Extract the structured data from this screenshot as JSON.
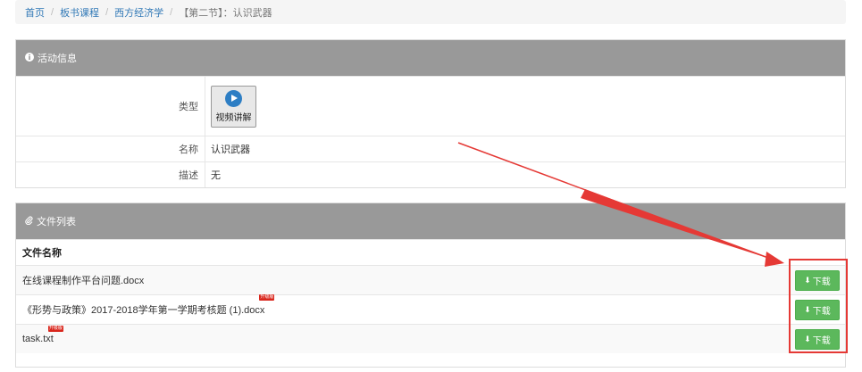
{
  "breadcrumb": {
    "home": "首页",
    "courses": "板书课程",
    "subject": "西方经济学",
    "current": "【第二节】：认识武器"
  },
  "activity": {
    "title": "活动信息",
    "type_label": "类型",
    "type_value": "视频讲解",
    "name_label": "名称",
    "name_value": "认识武器",
    "desc_label": "描述",
    "desc_value": "无"
  },
  "files": {
    "title": "文件列表",
    "column_header": "文件名称",
    "download_label": "下载",
    "badge_text": "升级版",
    "rows": [
      {
        "name": "在线课程制作平台问题.docx"
      },
      {
        "name": "《形势与政策》2017-2018学年第一学期考核题 (1).docx"
      },
      {
        "name": "task.txt"
      }
    ]
  },
  "colors": {
    "panel_header": "#999999",
    "link": "#337ab7",
    "download_button": "#5cb85c",
    "highlight": "#e53935"
  }
}
